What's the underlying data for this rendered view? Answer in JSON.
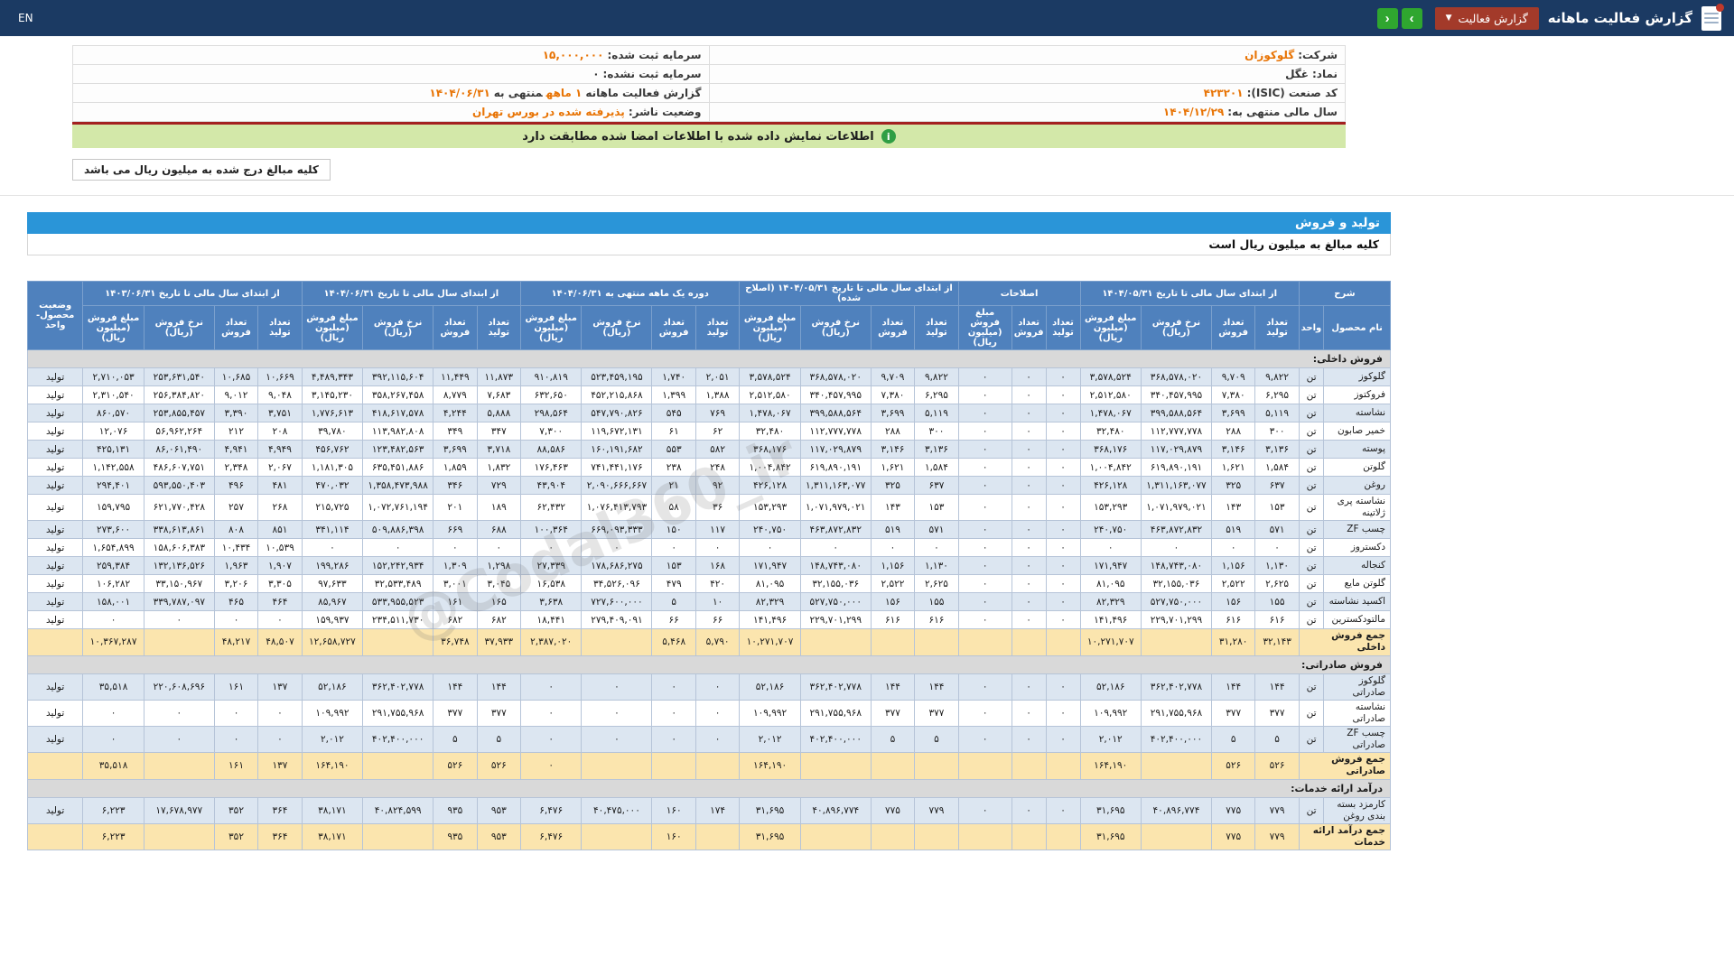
{
  "topbar": {
    "title": "گزارش فعالیت ماهانه",
    "dropdown_label": "گزارش فعالیت",
    "nav_next": "›",
    "nav_prev": "‹",
    "en_label": "EN",
    "dropdown_color": "#a33a2a",
    "bar_color": "#1b3a63",
    "nav_color": "#2fa62f"
  },
  "company": {
    "rows": [
      {
        "cells": [
          [
            {
              "t": "شرکت:",
              "k": "label"
            },
            {
              "t": "گلوکوزان",
              "k": "value"
            }
          ],
          [
            {
              "t": "سرمایه ثبت شده:",
              "k": "label"
            },
            {
              "t": "۱۵,۰۰۰,۰۰۰",
              "k": "value"
            }
          ]
        ]
      },
      {
        "cells": [
          [
            {
              "t": "نماد:",
              "k": "label"
            },
            {
              "t": "غگل",
              "k": "dark"
            }
          ],
          [
            {
              "t": "سرمایه ثبت نشده:",
              "k": "label"
            },
            {
              "t": "۰",
              "k": "dark"
            }
          ]
        ]
      },
      {
        "cells": [
          [
            {
              "t": "کد صنعت (ISIC):",
              "k": "label"
            },
            {
              "t": "۴۲۳۲۰۱",
              "k": "value"
            }
          ],
          [
            {
              "t": "گزارش فعالیت ماهانه",
              "k": "label"
            },
            {
              "t": "۱ ماهه",
              "k": "value"
            },
            {
              "t": "منتهی به",
              "k": "label"
            },
            {
              "t": "۱۴۰۴/۰۶/۳۱",
              "k": "value"
            }
          ]
        ]
      },
      {
        "cells": [
          [
            {
              "t": "سال مالی منتهی به:",
              "k": "label"
            },
            {
              "t": "۱۴۰۴/۱۲/۲۹",
              "k": "value"
            }
          ],
          [
            {
              "t": "وضعیت ناشر:",
              "k": "label"
            },
            {
              "t": "پذیرفته شده در بورس تهران",
              "k": "value"
            }
          ]
        ]
      }
    ]
  },
  "banner": {
    "text": "اطلاعات نمایش داده شده با اطلاعات امضا شده مطابقت دارد",
    "icon": "i"
  },
  "note": "کلیه مبالغ درج شده به میلیون ریال می باشد",
  "section_bar": "تولید و فروش",
  "units_note": "کلیه مبالغ به میلیون ریال است",
  "watermark": "@Codal360_ir",
  "table": {
    "group_keys": [
      "g05",
      "adj",
      "g05c",
      "m1",
      "g06",
      "g03"
    ],
    "header": {
      "desc": "شرح",
      "name_col": "نام محصول",
      "unit_col": "واحد",
      "status_col": "وضعیت محصول-واحد",
      "sub": {
        "prod": "تعداد تولید",
        "sold": "تعداد فروش",
        "rate": "نرخ فروش (ریال)",
        "amount": "مبلغ فروش (میلیون ریال)"
      },
      "groups": [
        {
          "key": "g05",
          "label": "از ابتدای سال مالی تا تاریخ ۱۴۰۴/۰۵/۳۱",
          "cols": 4
        },
        {
          "key": "adj",
          "label": "اصلاحات",
          "cols": 3
        },
        {
          "key": "g05c",
          "label": "از ابتدای سال مالی تا تاریخ ۱۴۰۴/۰۵/۳۱ (اصلاح شده)",
          "cols": 4
        },
        {
          "key": "m1",
          "label": "دوره یک ماهه منتهی به ۱۴۰۴/۰۶/۳۱",
          "cols": 4
        },
        {
          "key": "g06",
          "label": "از ابتدای سال مالی تا تاریخ ۱۴۰۴/۰۶/۳۱",
          "cols": 4
        },
        {
          "key": "g03",
          "label": "از ابتدای سال مالی تا تاریخ ۱۴۰۳/۰۶/۳۱",
          "cols": 4
        }
      ]
    },
    "rows": [
      {
        "type": "section",
        "name": "فروش داخلی:"
      },
      {
        "type": "product",
        "name": "گلوکوز",
        "unit": "تن",
        "status": "تولید",
        "g05": [
          "۹,۸۲۲",
          "۹,۷۰۹",
          "۳۶۸,۵۷۸,۰۲۰",
          "۳,۵۷۸,۵۲۴"
        ],
        "adj": [
          "۰",
          "۰",
          "۰"
        ],
        "g05c": [
          "۹,۸۲۲",
          "۹,۷۰۹",
          "۳۶۸,۵۷۸,۰۲۰",
          "۳,۵۷۸,۵۲۴"
        ],
        "m1": [
          "۲,۰۵۱",
          "۱,۷۴۰",
          "۵۲۳,۴۵۹,۱۹۵",
          "۹۱۰,۸۱۹"
        ],
        "g06": [
          "۱۱,۸۷۳",
          "۱۱,۴۴۹",
          "۳۹۲,۱۱۵,۶۰۴",
          "۴,۴۸۹,۳۴۳"
        ],
        "g03": [
          "۱۰,۶۶۹",
          "۱۰,۶۸۵",
          "۲۵۳,۶۳۱,۵۴۰",
          "۲,۷۱۰,۰۵۳"
        ]
      },
      {
        "type": "product",
        "name": "فروکتوز",
        "unit": "تن",
        "status": "تولید",
        "g05": [
          "۶,۲۹۵",
          "۷,۳۸۰",
          "۳۴۰,۴۵۷,۹۹۵",
          "۲,۵۱۲,۵۸۰"
        ],
        "adj": [
          "۰",
          "۰",
          "۰"
        ],
        "g05c": [
          "۶,۲۹۵",
          "۷,۳۸۰",
          "۳۴۰,۴۵۷,۹۹۵",
          "۲,۵۱۲,۵۸۰"
        ],
        "m1": [
          "۱,۳۸۸",
          "۱,۳۹۹",
          "۴۵۲,۲۱۵,۸۶۸",
          "۶۳۲,۶۵۰"
        ],
        "g06": [
          "۷,۶۸۳",
          "۸,۷۷۹",
          "۳۵۸,۲۶۷,۴۵۸",
          "۳,۱۴۵,۲۳۰"
        ],
        "g03": [
          "۹,۰۴۸",
          "۹,۰۱۲",
          "۲۵۶,۳۸۴,۸۲۰",
          "۲,۳۱۰,۵۴۰"
        ]
      },
      {
        "type": "product",
        "name": "نشاسته",
        "unit": "تن",
        "status": "تولید",
        "g05": [
          "۵,۱۱۹",
          "۳,۶۹۹",
          "۳۹۹,۵۸۸,۵۶۴",
          "۱,۴۷۸,۰۶۷"
        ],
        "adj": [
          "۰",
          "۰",
          "۰"
        ],
        "g05c": [
          "۵,۱۱۹",
          "۳,۶۹۹",
          "۳۹۹,۵۸۸,۵۶۴",
          "۱,۴۷۸,۰۶۷"
        ],
        "m1": [
          "۷۶۹",
          "۵۴۵",
          "۵۴۷,۷۹۰,۸۲۶",
          "۲۹۸,۵۶۴"
        ],
        "g06": [
          "۵,۸۸۸",
          "۴,۲۴۴",
          "۴۱۸,۶۱۷,۵۷۸",
          "۱,۷۷۶,۶۱۳"
        ],
        "g03": [
          "۳,۷۵۱",
          "۳,۳۹۰",
          "۲۵۳,۸۵۵,۴۵۷",
          "۸۶۰,۵۷۰"
        ]
      },
      {
        "type": "product",
        "name": "خمیر صابون",
        "unit": "تن",
        "status": "تولید",
        "g05": [
          "۳۰۰",
          "۲۸۸",
          "۱۱۲,۷۷۷,۷۷۸",
          "۳۲,۴۸۰"
        ],
        "adj": [
          "۰",
          "۰",
          "۰"
        ],
        "g05c": [
          "۳۰۰",
          "۲۸۸",
          "۱۱۲,۷۷۷,۷۷۸",
          "۳۲,۴۸۰"
        ],
        "m1": [
          "۶۲",
          "۶۱",
          "۱۱۹,۶۷۲,۱۳۱",
          "۷,۳۰۰"
        ],
        "g06": [
          "۳۴۷",
          "۳۴۹",
          "۱۱۳,۹۸۲,۸۰۸",
          "۳۹,۷۸۰"
        ],
        "g03": [
          "۲۰۸",
          "۲۱۲",
          "۵۶,۹۶۲,۲۶۴",
          "۱۲,۰۷۶"
        ]
      },
      {
        "type": "product",
        "name": "پوسته",
        "unit": "تن",
        "status": "تولید",
        "g05": [
          "۳,۱۳۶",
          "۳,۱۴۶",
          "۱۱۷,۰۲۹,۸۷۹",
          "۳۶۸,۱۷۶"
        ],
        "adj": [
          "۰",
          "۰",
          "۰"
        ],
        "g05c": [
          "۳,۱۳۶",
          "۳,۱۴۶",
          "۱۱۷,۰۲۹,۸۷۹",
          "۳۶۸,۱۷۶"
        ],
        "m1": [
          "۵۸۲",
          "۵۵۳",
          "۱۶۰,۱۹۱,۶۸۲",
          "۸۸,۵۸۶"
        ],
        "g06": [
          "۳,۷۱۸",
          "۳,۶۹۹",
          "۱۲۳,۴۸۲,۵۶۳",
          "۴۵۶,۷۶۲"
        ],
        "g03": [
          "۴,۹۴۹",
          "۴,۹۴۱",
          "۸۶,۰۶۱,۴۹۰",
          "۴۲۵,۱۳۱"
        ]
      },
      {
        "type": "product",
        "name": "گلوتن",
        "unit": "تن",
        "status": "تولید",
        "g05": [
          "۱,۵۸۴",
          "۱,۶۲۱",
          "۶۱۹,۸۹۰,۱۹۱",
          "۱,۰۰۴,۸۴۲"
        ],
        "adj": [
          "۰",
          "۰",
          "۰"
        ],
        "g05c": [
          "۱,۵۸۴",
          "۱,۶۲۱",
          "۶۱۹,۸۹۰,۱۹۱",
          "۱,۰۰۴,۸۴۲"
        ],
        "m1": [
          "۲۴۸",
          "۲۳۸",
          "۷۴۱,۴۴۱,۱۷۶",
          "۱۷۶,۴۶۳"
        ],
        "g06": [
          "۱,۸۳۲",
          "۱,۸۵۹",
          "۶۳۵,۴۵۱,۸۸۶",
          "۱,۱۸۱,۳۰۵"
        ],
        "g03": [
          "۲,۰۶۷",
          "۲,۳۴۸",
          "۴۸۶,۶۰۷,۷۵۱",
          "۱,۱۴۲,۵۵۸"
        ]
      },
      {
        "type": "product",
        "name": "روغن",
        "unit": "تن",
        "status": "تولید",
        "g05": [
          "۶۳۷",
          "۳۲۵",
          "۱,۳۱۱,۱۶۳,۰۷۷",
          "۴۲۶,۱۲۸"
        ],
        "adj": [
          "۰",
          "۰",
          "۰"
        ],
        "g05c": [
          "۶۳۷",
          "۳۲۵",
          "۱,۳۱۱,۱۶۳,۰۷۷",
          "۴۲۶,۱۲۸"
        ],
        "m1": [
          "۹۲",
          "۲۱",
          "۲,۰۹۰,۶۶۶,۶۶۷",
          "۴۳,۹۰۴"
        ],
        "g06": [
          "۷۲۹",
          "۳۴۶",
          "۱,۳۵۸,۴۷۳,۹۸۸",
          "۴۷۰,۰۳۲"
        ],
        "g03": [
          "۴۸۱",
          "۴۹۶",
          "۵۹۳,۵۵۰,۴۰۳",
          "۲۹۴,۴۰۱"
        ]
      },
      {
        "type": "product",
        "name": "نشاسته پری ژلاتینه",
        "unit": "تن",
        "status": "تولید",
        "g05": [
          "۱۵۳",
          "۱۴۳",
          "۱,۰۷۱,۹۷۹,۰۲۱",
          "۱۵۳,۲۹۳"
        ],
        "adj": [
          "۰",
          "۰",
          "۰"
        ],
        "g05c": [
          "۱۵۳",
          "۱۴۳",
          "۱,۰۷۱,۹۷۹,۰۲۱",
          "۱۵۳,۲۹۳"
        ],
        "m1": [
          "۳۶",
          "۵۸",
          "۱,۰۷۶,۴۱۳,۷۹۳",
          "۶۲,۴۳۲"
        ],
        "g06": [
          "۱۸۹",
          "۲۰۱",
          "۱,۰۷۲,۷۶۱,۱۹۴",
          "۲۱۵,۷۲۵"
        ],
        "g03": [
          "۲۶۸",
          "۲۵۷",
          "۶۲۱,۷۷۰,۴۲۸",
          "۱۵۹,۷۹۵"
        ]
      },
      {
        "type": "product",
        "name": "چسب ZF",
        "unit": "تن",
        "status": "تولید",
        "g05": [
          "۵۷۱",
          "۵۱۹",
          "۴۶۳,۸۷۲,۸۳۲",
          "۲۴۰,۷۵۰"
        ],
        "adj": [
          "۰",
          "۰",
          "۰"
        ],
        "g05c": [
          "۵۷۱",
          "۵۱۹",
          "۴۶۳,۸۷۲,۸۳۲",
          "۲۴۰,۷۵۰"
        ],
        "m1": [
          "۱۱۷",
          "۱۵۰",
          "۶۶۹,۰۹۳,۳۳۳",
          "۱۰۰,۳۶۴"
        ],
        "g06": [
          "۶۸۸",
          "۶۶۹",
          "۵۰۹,۸۸۶,۳۹۸",
          "۳۴۱,۱۱۴"
        ],
        "g03": [
          "۸۵۱",
          "۸۰۸",
          "۳۳۸,۶۱۳,۸۶۱",
          "۲۷۳,۶۰۰"
        ]
      },
      {
        "type": "product",
        "name": "دکستروز",
        "unit": "تن",
        "status": "تولید",
        "g05": [
          "۰",
          "۰",
          "۰",
          "۰"
        ],
        "adj": [
          "۰",
          "۰",
          "۰"
        ],
        "g05c": [
          "۰",
          "۰",
          "۰",
          "۰"
        ],
        "m1": [
          "۰",
          "۰",
          "۰",
          "۰"
        ],
        "g06": [
          "۰",
          "۰",
          "۰",
          "۰"
        ],
        "g03": [
          "۱۰,۵۳۹",
          "۱۰,۴۳۴",
          "۱۵۸,۶۰۶,۳۸۳",
          "۱,۶۵۴,۸۹۹"
        ]
      },
      {
        "type": "product",
        "name": "کنجاله",
        "unit": "تن",
        "status": "تولید",
        "g05": [
          "۱,۱۳۰",
          "۱,۱۵۶",
          "۱۴۸,۷۴۳,۰۸۰",
          "۱۷۱,۹۴۷"
        ],
        "adj": [
          "۰",
          "۰",
          "۰"
        ],
        "g05c": [
          "۱,۱۳۰",
          "۱,۱۵۶",
          "۱۴۸,۷۴۳,۰۸۰",
          "۱۷۱,۹۴۷"
        ],
        "m1": [
          "۱۶۸",
          "۱۵۳",
          "۱۷۸,۶۸۶,۲۷۵",
          "۲۷,۳۳۹"
        ],
        "g06": [
          "۱,۲۹۸",
          "۱,۳۰۹",
          "۱۵۲,۲۴۲,۹۳۴",
          "۱۹۹,۲۸۶"
        ],
        "g03": [
          "۱,۹۰۷",
          "۱,۹۶۳",
          "۱۳۲,۱۳۶,۵۲۶",
          "۲۵۹,۳۸۴"
        ]
      },
      {
        "type": "product",
        "name": "گلوتن مایع",
        "unit": "تن",
        "status": "تولید",
        "g05": [
          "۲,۶۲۵",
          "۲,۵۲۲",
          "۳۲,۱۵۵,۰۳۶",
          "۸۱,۰۹۵"
        ],
        "adj": [
          "۰",
          "۰",
          "۰"
        ],
        "g05c": [
          "۲,۶۲۵",
          "۲,۵۲۲",
          "۳۲,۱۵۵,۰۳۶",
          "۸۱,۰۹۵"
        ],
        "m1": [
          "۴۲۰",
          "۴۷۹",
          "۳۴,۵۲۶,۰۹۶",
          "۱۶,۵۳۸"
        ],
        "g06": [
          "۳,۰۴۵",
          "۳,۰۰۱",
          "۳۲,۵۳۳,۴۸۹",
          "۹۷,۶۳۳"
        ],
        "g03": [
          "۳,۳۰۵",
          "۳,۲۰۶",
          "۳۳,۱۵۰,۹۶۷",
          "۱۰۶,۲۸۲"
        ]
      },
      {
        "type": "product",
        "name": "اکسید نشاسته",
        "unit": "تن",
        "status": "تولید",
        "g05": [
          "۱۵۵",
          "۱۵۶",
          "۵۲۷,۷۵۰,۰۰۰",
          "۸۲,۳۲۹"
        ],
        "adj": [
          "۰",
          "۰",
          "۰"
        ],
        "g05c": [
          "۱۵۵",
          "۱۵۶",
          "۵۲۷,۷۵۰,۰۰۰",
          "۸۲,۳۲۹"
        ],
        "m1": [
          "۱۰",
          "۵",
          "۷۲۷,۶۰۰,۰۰۰",
          "۳,۶۳۸"
        ],
        "g06": [
          "۱۶۵",
          "۱۶۱",
          "۵۳۳,۹۵۵,۵۲۳",
          "۸۵,۹۶۷"
        ],
        "g03": [
          "۴۶۴",
          "۴۶۵",
          "۳۳۹,۷۸۷,۰۹۷",
          "۱۵۸,۰۰۱"
        ]
      },
      {
        "type": "product",
        "name": "مالتودکسترین",
        "unit": "تن",
        "status": "تولید",
        "g05": [
          "۶۱۶",
          "۶۱۶",
          "۲۲۹,۷۰۱,۲۹۹",
          "۱۴۱,۴۹۶"
        ],
        "adj": [
          "۰",
          "۰",
          "۰"
        ],
        "g05c": [
          "۶۱۶",
          "۶۱۶",
          "۲۲۹,۷۰۱,۲۹۹",
          "۱۴۱,۴۹۶"
        ],
        "m1": [
          "۶۶",
          "۶۶",
          "۲۷۹,۴۰۹,۰۹۱",
          "۱۸,۴۴۱"
        ],
        "g06": [
          "۶۸۲",
          "۶۸۲",
          "۲۳۴,۵۱۱,۷۳۰",
          "۱۵۹,۹۳۷"
        ],
        "g03": [
          "۰",
          "۰",
          "۰",
          "۰"
        ]
      },
      {
        "type": "total",
        "name": "جمع فروش داخلی",
        "status": "",
        "g05": [
          "۳۲,۱۴۳",
          "۳۱,۲۸۰",
          "",
          "۱۰,۲۷۱,۷۰۷"
        ],
        "adj": [
          "",
          "",
          ""
        ],
        "g05c": [
          "",
          "",
          "",
          "۱۰,۲۷۱,۷۰۷"
        ],
        "m1": [
          "۵,۷۹۰",
          "۵,۴۶۸",
          "",
          "۲,۳۸۷,۰۲۰"
        ],
        "g06": [
          "۳۷,۹۳۳",
          "۳۶,۷۴۸",
          "",
          "۱۲,۶۵۸,۷۲۷"
        ],
        "g03": [
          "۴۸,۵۰۷",
          "۴۸,۲۱۷",
          "",
          "۱۰,۳۶۷,۲۸۷"
        ]
      },
      {
        "type": "section",
        "name": "فروش صادراتی:"
      },
      {
        "type": "product",
        "name": "گلوکوز صادراتی",
        "unit": "تن",
        "status": "تولید",
        "g05": [
          "۱۴۴",
          "۱۴۴",
          "۳۶۲,۴۰۲,۷۷۸",
          "۵۲,۱۸۶"
        ],
        "adj": [
          "۰",
          "۰",
          "۰"
        ],
        "g05c": [
          "۱۴۴",
          "۱۴۴",
          "۳۶۲,۴۰۲,۷۷۸",
          "۵۲,۱۸۶"
        ],
        "m1": [
          "۰",
          "۰",
          "۰",
          "۰"
        ],
        "g06": [
          "۱۴۴",
          "۱۴۴",
          "۳۶۲,۴۰۲,۷۷۸",
          "۵۲,۱۸۶"
        ],
        "g03": [
          "۱۳۷",
          "۱۶۱",
          "۲۲۰,۶۰۸,۶۹۶",
          "۳۵,۵۱۸"
        ]
      },
      {
        "type": "product",
        "name": "نشاسته صادراتی",
        "unit": "تن",
        "status": "تولید",
        "g05": [
          "۳۷۷",
          "۳۷۷",
          "۲۹۱,۷۵۵,۹۶۸",
          "۱۰۹,۹۹۲"
        ],
        "adj": [
          "۰",
          "۰",
          "۰"
        ],
        "g05c": [
          "۳۷۷",
          "۳۷۷",
          "۲۹۱,۷۵۵,۹۶۸",
          "۱۰۹,۹۹۲"
        ],
        "m1": [
          "۰",
          "۰",
          "۰",
          "۰"
        ],
        "g06": [
          "۳۷۷",
          "۳۷۷",
          "۲۹۱,۷۵۵,۹۶۸",
          "۱۰۹,۹۹۲"
        ],
        "g03": [
          "۰",
          "۰",
          "۰",
          "۰"
        ]
      },
      {
        "type": "product",
        "name": "چسب ZF صادراتی",
        "unit": "تن",
        "status": "تولید",
        "g05": [
          "۵",
          "۵",
          "۴۰۲,۴۰۰,۰۰۰",
          "۲,۰۱۲"
        ],
        "adj": [
          "۰",
          "۰",
          "۰"
        ],
        "g05c": [
          "۵",
          "۵",
          "۴۰۲,۴۰۰,۰۰۰",
          "۲,۰۱۲"
        ],
        "m1": [
          "۰",
          "۰",
          "۰",
          "۰"
        ],
        "g06": [
          "۵",
          "۵",
          "۴۰۲,۴۰۰,۰۰۰",
          "۲,۰۱۲"
        ],
        "g03": [
          "۰",
          "۰",
          "۰",
          "۰"
        ]
      },
      {
        "type": "total",
        "name": "جمع فروش صادراتی",
        "status": "",
        "g05": [
          "۵۲۶",
          "۵۲۶",
          "",
          "۱۶۴,۱۹۰"
        ],
        "adj": [
          "",
          "",
          ""
        ],
        "g05c": [
          "",
          "",
          "",
          "۱۶۴,۱۹۰"
        ],
        "m1": [
          "",
          "",
          "",
          "۰"
        ],
        "g06": [
          "۵۲۶",
          "۵۲۶",
          "",
          "۱۶۴,۱۹۰"
        ],
        "g03": [
          "۱۳۷",
          "۱۶۱",
          "",
          "۳۵,۵۱۸"
        ]
      },
      {
        "type": "section",
        "name": "درآمد ارائه خدمات:"
      },
      {
        "type": "product",
        "name": "کارمزد بسته بندی روغن",
        "unit": "تن",
        "status": "تولید",
        "g05": [
          "۷۷۹",
          "۷۷۵",
          "۴۰,۸۹۶,۷۷۴",
          "۳۱,۶۹۵"
        ],
        "adj": [
          "۰",
          "۰",
          "۰"
        ],
        "g05c": [
          "۷۷۹",
          "۷۷۵",
          "۴۰,۸۹۶,۷۷۴",
          "۳۱,۶۹۵"
        ],
        "m1": [
          "۱۷۴",
          "۱۶۰",
          "۴۰,۴۷۵,۰۰۰",
          "۶,۴۷۶"
        ],
        "g06": [
          "۹۵۳",
          "۹۳۵",
          "۴۰,۸۲۴,۵۹۹",
          "۳۸,۱۷۱"
        ],
        "g03": [
          "۳۶۴",
          "۳۵۲",
          "۱۷,۶۷۸,۹۷۷",
          "۶,۲۲۳"
        ]
      },
      {
        "type": "total",
        "name": "جمع درآمد ارائه خدمات",
        "status": "",
        "g05": [
          "۷۷۹",
          "۷۷۵",
          "",
          "۳۱,۶۹۵"
        ],
        "adj": [
          "",
          "",
          ""
        ],
        "g05c": [
          "",
          "",
          "",
          "۳۱,۶۹۵"
        ],
        "m1": [
          "",
          "۱۶۰",
          "",
          "۶,۴۷۶"
        ],
        "g06": [
          "۹۵۳",
          "۹۳۵",
          "",
          "۳۸,۱۷۱"
        ],
        "g03": [
          "۳۶۴",
          "۳۵۲",
          "",
          "۶,۲۲۳"
        ]
      }
    ]
  }
}
